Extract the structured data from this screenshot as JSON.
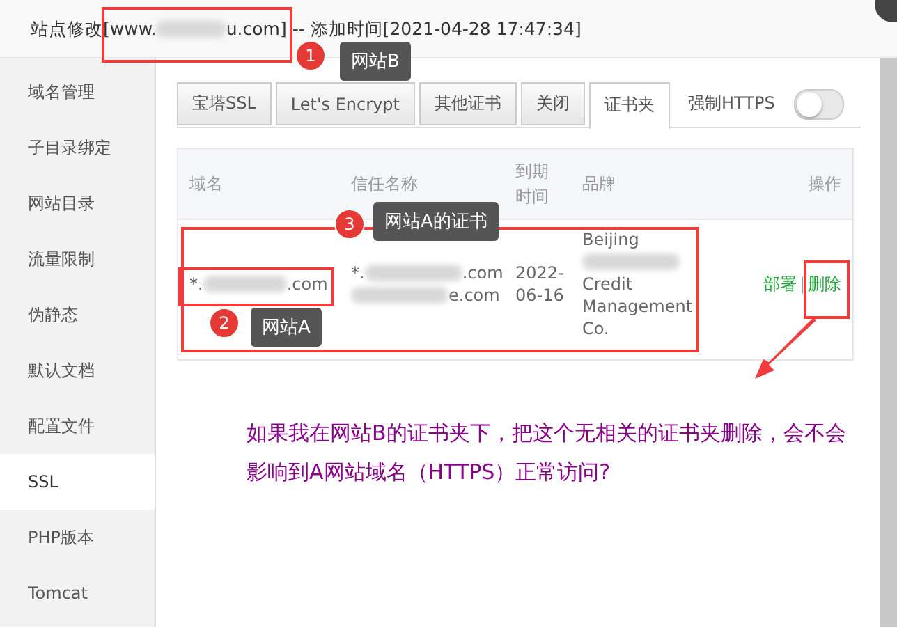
{
  "window": {
    "title_start": "站点修改[www.",
    "title_end": "u.com] -- 添加时间[2021-04-28 17:47:34]"
  },
  "sidebar": {
    "items": [
      {
        "label": "域名管理",
        "selected": false
      },
      {
        "label": "子目录绑定",
        "selected": false
      },
      {
        "label": "网站目录",
        "selected": false
      },
      {
        "label": "流量限制",
        "selected": false
      },
      {
        "label": "伪静态",
        "selected": false
      },
      {
        "label": "默认文档",
        "selected": false
      },
      {
        "label": "配置文件",
        "selected": false
      },
      {
        "label": "SSL",
        "selected": true
      },
      {
        "label": "PHP版本",
        "selected": false
      },
      {
        "label": "Tomcat",
        "selected": false
      }
    ]
  },
  "tabs": [
    {
      "label": "宝塔SSL",
      "selected": false
    },
    {
      "label": "Let's Encrypt",
      "selected": false
    },
    {
      "label": "其他证书",
      "selected": false
    },
    {
      "label": "关闭",
      "selected": false
    },
    {
      "label": "证书夹",
      "selected": true
    }
  ],
  "force_https": {
    "label": "强制HTTPS",
    "on": false
  },
  "table": {
    "columns": [
      "域名",
      "信任名称",
      "到期时间",
      "品牌",
      "操作"
    ],
    "rows": [
      {
        "domain": {
          "start": "*.",
          "end": ".com"
        },
        "trust_names": [
          {
            "start": "*.",
            "end": ".com"
          },
          {
            "end": "e.com"
          }
        ],
        "expiry": "2022-\n06-16",
        "brand": {
          "start": "Beijing",
          "end": "Credit\nManagement\nCo."
        },
        "actions": [
          "部署",
          "删除"
        ],
        "separator": "|"
      }
    ]
  },
  "annotations": [
    {
      "number": "1",
      "label": "网站B"
    },
    {
      "number": "2",
      "label": "网站A"
    },
    {
      "number": "3",
      "label": "网站A的证书"
    }
  ],
  "question": "如果我在网站B的证书夹下，把这个无相关的证书夹删除，会不会影响到A网站域名（HTTPS）正常访问?"
}
